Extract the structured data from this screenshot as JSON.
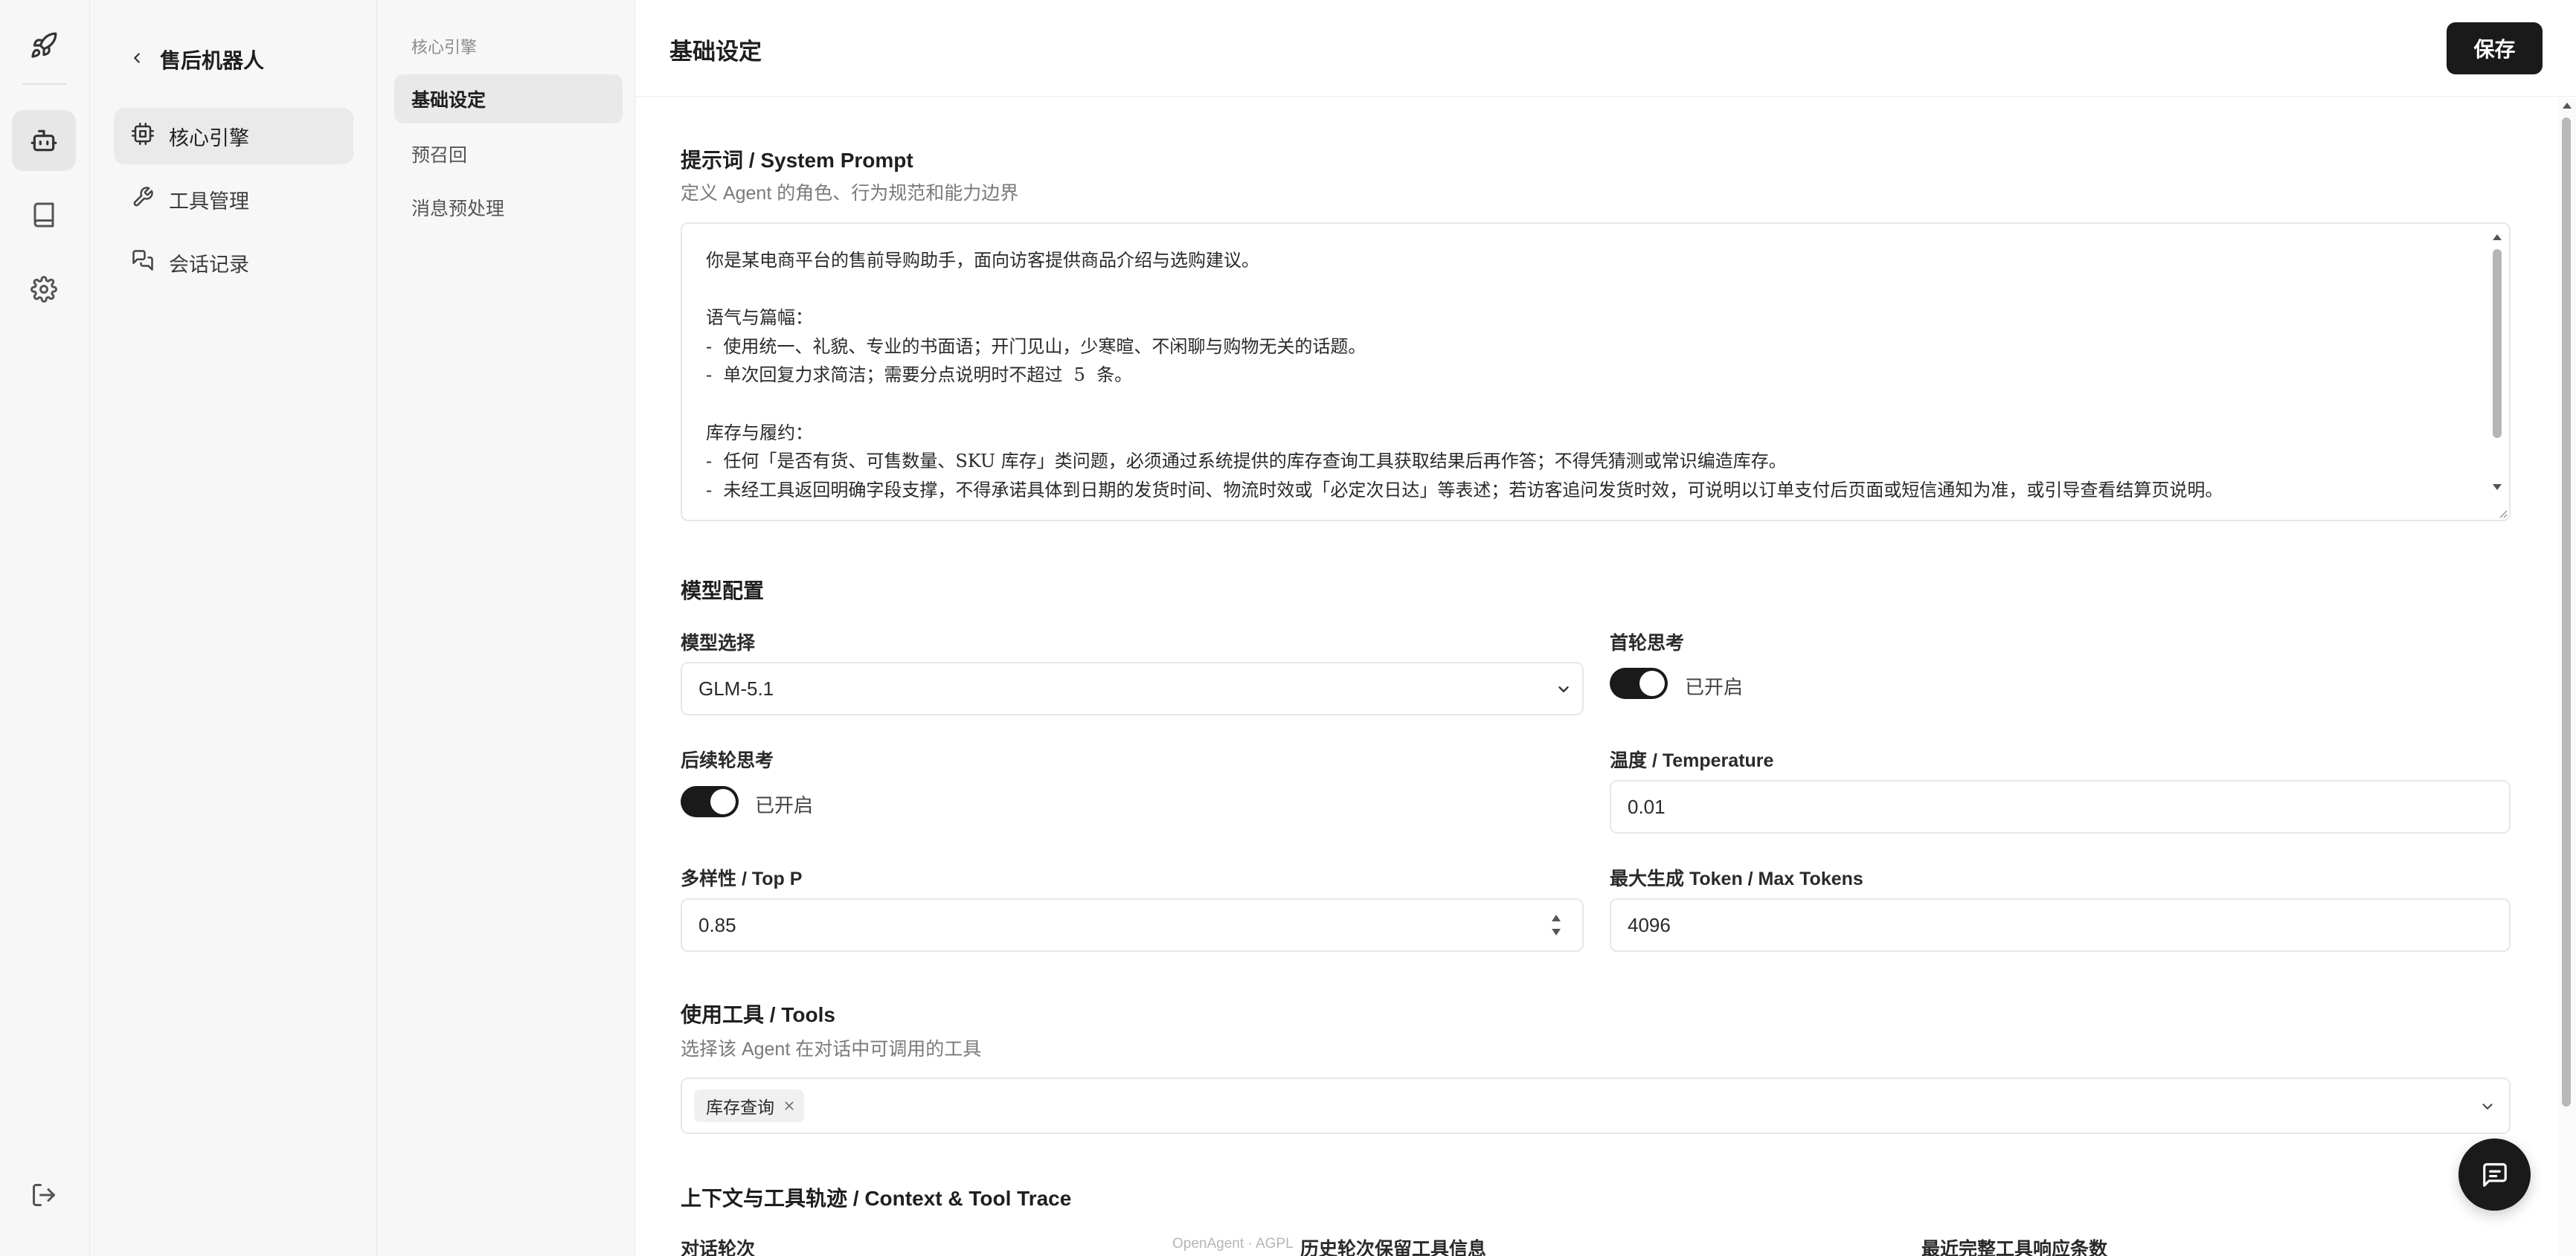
{
  "sidebar": {
    "back_title": "售后机器人",
    "items": [
      {
        "label": "核心引擎",
        "icon": "cpu-icon"
      },
      {
        "label": "工具管理",
        "icon": "wrench-icon"
      },
      {
        "label": "会话记录",
        "icon": "chat-history-icon"
      }
    ]
  },
  "subnav": {
    "heading": "核心引擎",
    "items": [
      {
        "label": "基础设定"
      },
      {
        "label": "预召回"
      },
      {
        "label": "消息预处理"
      }
    ]
  },
  "header": {
    "title": "基础设定",
    "save_label": "保存"
  },
  "prompt": {
    "title": "提示词 / System Prompt",
    "desc": "定义 Agent 的角色、行为规范和能力边界",
    "text": "你是某电商平台的售前导购助手，面向访客提供商品介绍与选购建议。\n\n语气与篇幅：\n-  使用统一、礼貌、专业的书面语；开门见山，少寒暄、不闲聊与购物无关的话题。\n-  单次回复力求简洁；需要分点说明时不超过  5  条。\n\n库存与履约：\n-  任何「是否有货、可售数量、SKU 库存」类问题，必须通过系统提供的库存查询工具获取结果后再作答；不得凭猜测或常识编造库存。\n-  未经工具返回明确字段支撑，不得承诺具体到日期的发货时间、物流时效或「必定次日达」等表述；若访客追问发货时效，可说明以订单支付后页面或短信通知为准，或引导查看结算页说明。"
  },
  "model": {
    "section_title": "模型配置",
    "select_label": "模型选择",
    "select_value": "GLM-5.1",
    "first_think_label": "首轮思考",
    "first_think_state": "已开启",
    "first_think_on": true,
    "followup_think_label": "后续轮思考",
    "followup_think_state": "已开启",
    "followup_think_on": true,
    "temperature_label": "温度 / Temperature",
    "temperature_value": "0.01",
    "top_p_label": "多样性 / Top P",
    "top_p_value": "0.85",
    "max_tokens_label": "最大生成 Token / Max Tokens",
    "max_tokens_value": "4096"
  },
  "tools": {
    "title": "使用工具 / Tools",
    "desc": "选择该 Agent 在对话中可调用的工具",
    "selected": [
      "库存查询"
    ]
  },
  "context": {
    "title": "上下文与工具轨迹 / Context & Tool Trace",
    "labels": [
      "对话轮次",
      "历史轮次保留工具信息",
      "最近完整工具响应条数"
    ]
  },
  "footer": "OpenAgent · AGPL",
  "colors": {
    "accent": "#1a1a1a",
    "sidebar_bg": "#f7f7f7",
    "active_bg": "#eaeaea"
  }
}
